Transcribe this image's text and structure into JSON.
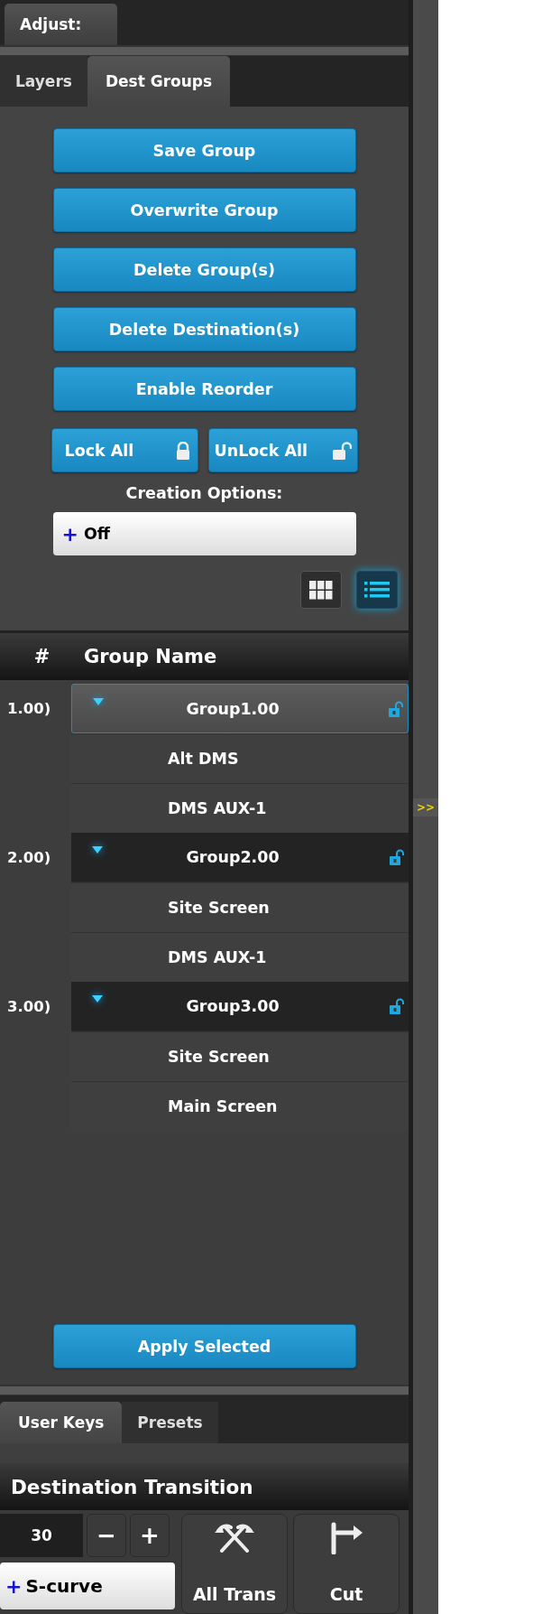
{
  "adjust_tab": {
    "label": "Adjust:"
  },
  "panel_tabs": [
    {
      "label": "Layers",
      "selected": false
    },
    {
      "label": "Dest Groups",
      "selected": true
    }
  ],
  "actions": [
    "Save Group",
    "Overwrite Group",
    "Delete Group(s)",
    "Delete Destination(s)",
    "Enable Reorder"
  ],
  "lock_buttons": [
    {
      "label": "Lock All",
      "kind": "lock"
    },
    {
      "label": "UnLock All",
      "kind": "unlock"
    }
  ],
  "creation_options": {
    "label": "Creation Options:",
    "prefix": "+",
    "value": "Off"
  },
  "view_toggle": [
    {
      "kind": "grid",
      "selected": false
    },
    {
      "kind": "list",
      "selected": true
    }
  ],
  "table": {
    "columns": [
      "#",
      "Group Name"
    ],
    "groups": [
      {
        "number": "1.00)",
        "name": "Group1.00",
        "selected": true,
        "expanded": true,
        "locked": false,
        "children": [
          {
            "name": "Alt DMS"
          },
          {
            "name": "DMS AUX-1"
          }
        ]
      },
      {
        "number": "2.00)",
        "name": "Group2.00",
        "selected": false,
        "expanded": true,
        "locked": false,
        "children": [
          {
            "name": "Site Screen"
          },
          {
            "name": "DMS AUX-1"
          }
        ]
      },
      {
        "number": "3.00)",
        "name": "Group3.00",
        "selected": false,
        "expanded": true,
        "locked": false,
        "children": [
          {
            "name": "Site Screen"
          },
          {
            "name": "Main Screen"
          }
        ]
      }
    ]
  },
  "apply_button": "Apply Selected",
  "bottom_tabs": [
    {
      "label": "User Keys",
      "selected": true
    },
    {
      "label": "Presets",
      "selected": false
    }
  ],
  "transition": {
    "title": "Destination Transition",
    "duration": "30",
    "minus": "−",
    "plus": "+",
    "curve_prefix": "+",
    "curve": "S-curve",
    "buttons": [
      {
        "label": "All Trans",
        "kind": "all"
      },
      {
        "label": "Cut",
        "kind": "cut"
      }
    ]
  },
  "side_strip": {
    "expand": ">>"
  }
}
